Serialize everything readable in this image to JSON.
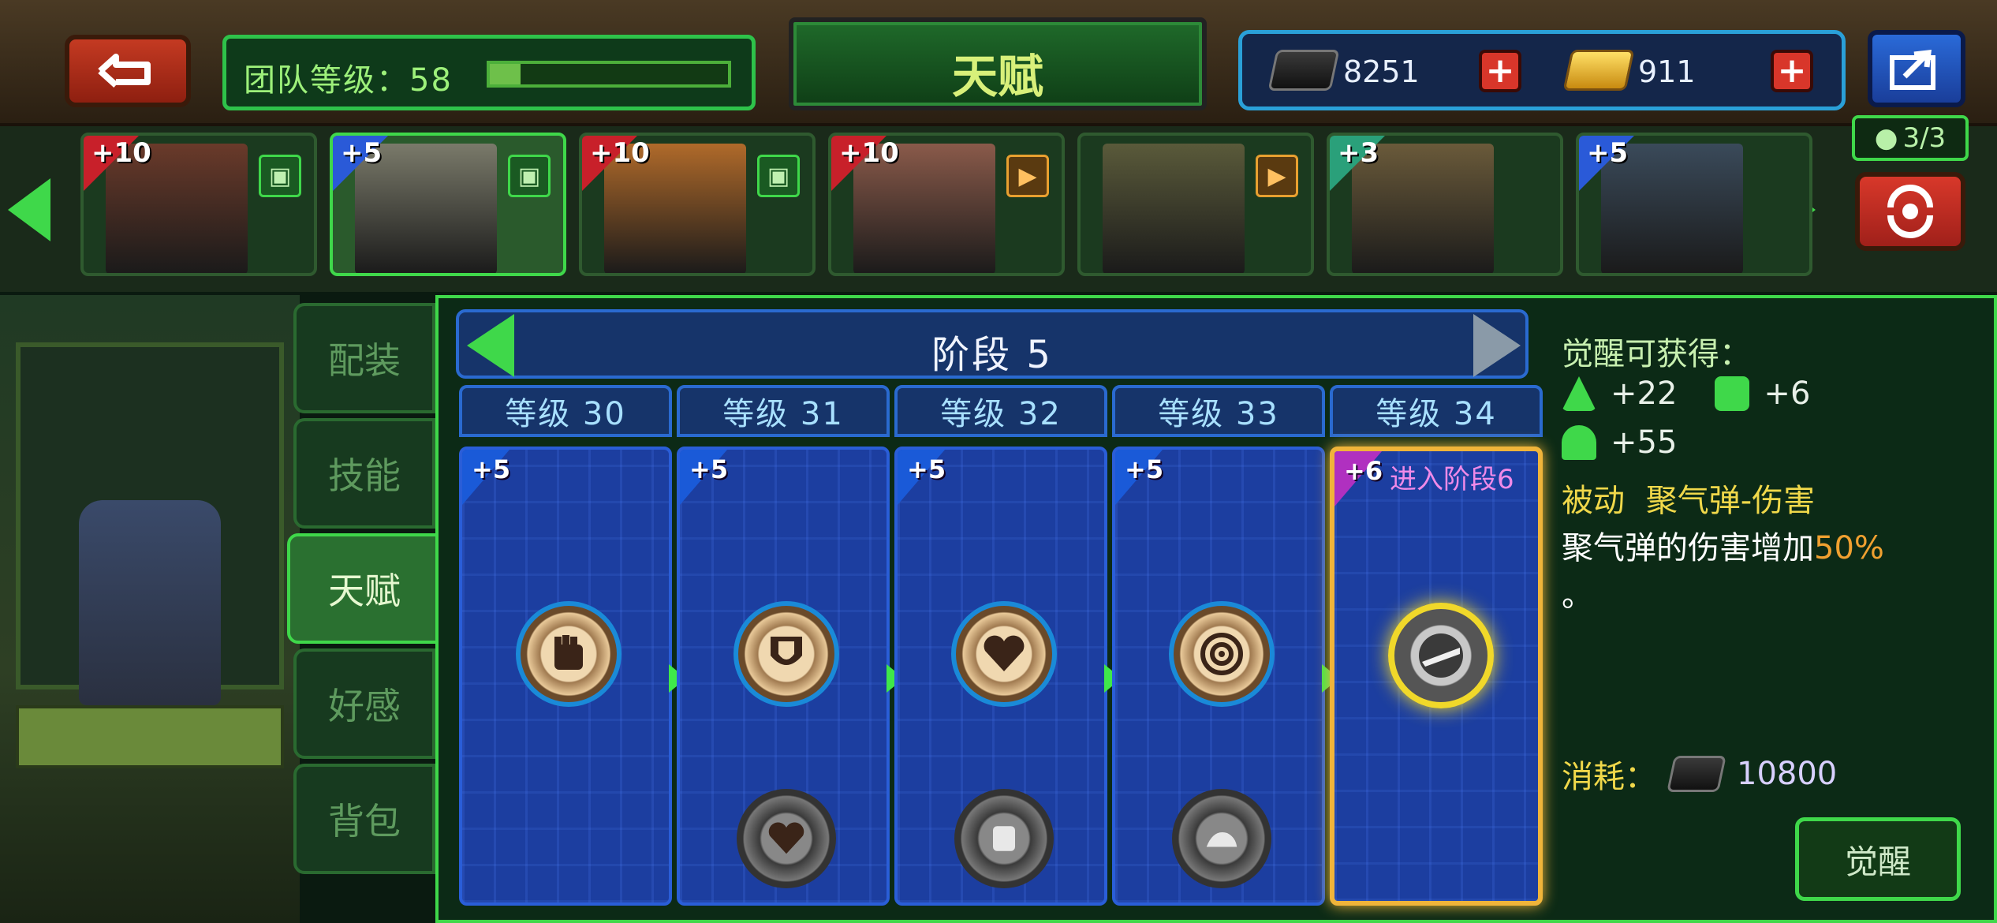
{
  "top": {
    "team_label": "团队等级：58",
    "team_progress": 0.13,
    "title": "天赋",
    "currency": [
      {
        "name": "silver-ingot-icon",
        "value": "8251"
      },
      {
        "name": "gold-bar-icon",
        "value": "911"
      }
    ],
    "plus_glyph": "+"
  },
  "heroes": [
    {
      "bonus": "+10",
      "badge_color": "#c8202a",
      "role": "support",
      "selected": false,
      "portrait": "#6a3a2a"
    },
    {
      "bonus": "+5",
      "badge_color": "#2a5ad8",
      "role": "support",
      "selected": true,
      "portrait": "#7a7a6a"
    },
    {
      "bonus": "+10",
      "badge_color": "#c8202a",
      "role": "support",
      "selected": false,
      "portrait": "#b06a2a"
    },
    {
      "bonus": "+10",
      "badge_color": "#c8202a",
      "role": "assault",
      "selected": false,
      "portrait": "#8a5a4a"
    },
    {
      "bonus": "",
      "badge_color": "",
      "role": "assault",
      "selected": false,
      "portrait": "#5a5a3a"
    },
    {
      "bonus": "+3",
      "badge_color": "#2aa07a",
      "role": "",
      "selected": false,
      "portrait": "#6a5a3a"
    },
    {
      "bonus": "+5",
      "badge_color": "#2a5ad8",
      "role": "",
      "selected": false,
      "portrait": "#3a4a5a"
    }
  ],
  "squad_count": "3/3",
  "tabs": [
    "配装",
    "技能",
    "天赋",
    "好感",
    "背包"
  ],
  "active_tab": 2,
  "stage": {
    "label": "阶段 5"
  },
  "levels": [
    {
      "label": "等级 30",
      "bonus": "+5",
      "icon": "fist-icon",
      "locked_icon": "",
      "current": false
    },
    {
      "label": "等级 31",
      "bonus": "+5",
      "icon": "shield-icon",
      "locked_icon": "heart-icon",
      "current": false
    },
    {
      "label": "等级 32",
      "bonus": "+5",
      "icon": "heart-icon",
      "locked_icon": "armor-icon",
      "current": false
    },
    {
      "label": "等级 33",
      "bonus": "+5",
      "icon": "target-icon",
      "locked_icon": "muscle-icon",
      "current": false
    },
    {
      "label": "等级 34",
      "bonus": "+6",
      "icon": "charged-shot-icon",
      "locked_icon": "",
      "current": true,
      "enter_text": "进入阶段6"
    }
  ],
  "info": {
    "header": "觉醒可获得：",
    "stat1": "+22",
    "stat2": "+6",
    "stat3": "+55",
    "passive_label": "被动",
    "passive_name": "聚气弹-伤害",
    "desc_prefix": "聚气弹的伤害增加",
    "desc_value": "50%",
    "desc_end": "。",
    "cost_label": "消耗：",
    "cost_value": "10800",
    "awaken_button": "觉醒"
  },
  "colors": {
    "accent_green": "#3fd84a",
    "gold": "#f0b43a",
    "highlight_orange": "#f0a030",
    "pink": "#f08ae8"
  }
}
